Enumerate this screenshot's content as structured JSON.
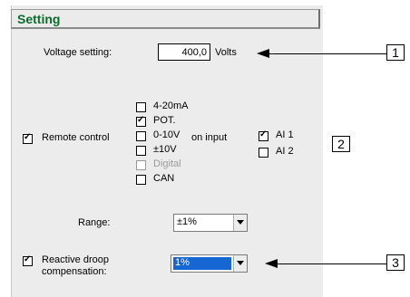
{
  "panel": {
    "title": "Setting",
    "voltage": {
      "label": "Voltage setting:",
      "value": "400,0",
      "unit": "Volts"
    },
    "remote": {
      "label": "Remote control",
      "checked": true,
      "options": [
        {
          "label": "4-20mA",
          "checked": false,
          "enabled": true
        },
        {
          "label": "POT.",
          "checked": true,
          "enabled": true
        },
        {
          "label": "0-10V",
          "checked": false,
          "enabled": true
        },
        {
          "label": "±10V",
          "checked": false,
          "enabled": true
        },
        {
          "label": "Digital",
          "checked": false,
          "enabled": false
        },
        {
          "label": "CAN",
          "checked": false,
          "enabled": true
        }
      ],
      "on_input_label": "on input",
      "inputs": [
        {
          "label": "AI 1",
          "checked": true
        },
        {
          "label": "AI 2",
          "checked": false
        }
      ]
    },
    "range": {
      "label": "Range:",
      "value": "±1%"
    },
    "droop": {
      "label_line1": "Reactive droop",
      "label_line2": "compensation:",
      "checked": true,
      "value": "1%"
    }
  },
  "callouts": [
    "1",
    "2",
    "3"
  ],
  "icons": {
    "check": "check-mark-icon",
    "dropdown": "chevron-down-icon"
  }
}
